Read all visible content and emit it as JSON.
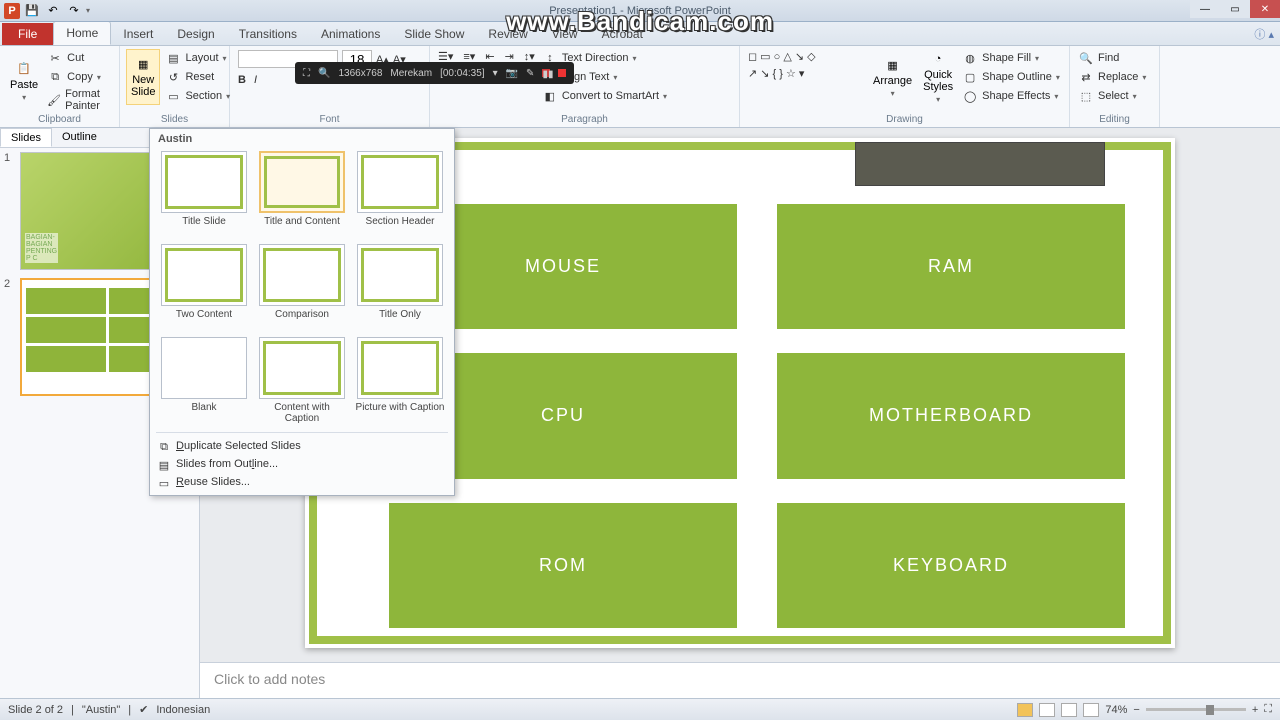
{
  "title": "Presentation1 - Microsoft PowerPoint",
  "watermark": "www.Bandicam.com",
  "tabs": {
    "file": "File",
    "home": "Home",
    "insert": "Insert",
    "design": "Design",
    "transitions": "Transitions",
    "animations": "Animations",
    "slideshow": "Slide Show",
    "review": "Review",
    "view": "View",
    "acrobat": "Acrobat"
  },
  "ribbon": {
    "clipboard": {
      "label": "Clipboard",
      "paste": "Paste",
      "cut": "Cut",
      "copy": "Copy",
      "format_painter": "Format Painter"
    },
    "slides": {
      "label": "Slides",
      "new_slide": "New\nSlide",
      "layout": "Layout",
      "reset": "Reset",
      "section": "Section"
    },
    "font": {
      "label": "Font",
      "size": "18"
    },
    "paragraph": {
      "label": "Paragraph",
      "text_direction": "Text Direction",
      "align_text": "Align Text",
      "convert_smartart": "Convert to SmartArt"
    },
    "drawing": {
      "label": "Drawing",
      "arrange": "Arrange",
      "quick_styles": "Quick\nStyles",
      "shape_fill": "Shape Fill",
      "shape_outline": "Shape Outline",
      "shape_effects": "Shape Effects"
    },
    "editing": {
      "label": "Editing",
      "find": "Find",
      "replace": "Replace",
      "select": "Select"
    }
  },
  "bandicam": {
    "res": "1366x768",
    "status": "Merekam",
    "time": "[00:04:35]"
  },
  "thumbs": {
    "tab_slides": "Slides",
    "tab_outline": "Outline",
    "s1": "1",
    "s2": "2",
    "s1_caption": "BAGIAN-\nBAGIAN\nPENTING\nP C"
  },
  "dropdown": {
    "theme": "Austin",
    "items": [
      "Title Slide",
      "Title and Content",
      "Section Header",
      "Two Content",
      "Comparison",
      "Title Only",
      "Blank",
      "Content with Caption",
      "Picture with Caption"
    ],
    "menu": [
      "Duplicate Selected Slides",
      "Slides from Outline...",
      "Reuse Slides..."
    ]
  },
  "slide": {
    "boxes": [
      "MOUSE",
      "RAM",
      "CPU",
      "MOTHERBOARD",
      "ROM",
      "KEYBOARD"
    ]
  },
  "notes_placeholder": "Click to add notes",
  "status": {
    "slide": "Slide 2 of 2",
    "theme": "\"Austin\"",
    "lang": "Indonesian",
    "zoom": "74%"
  }
}
